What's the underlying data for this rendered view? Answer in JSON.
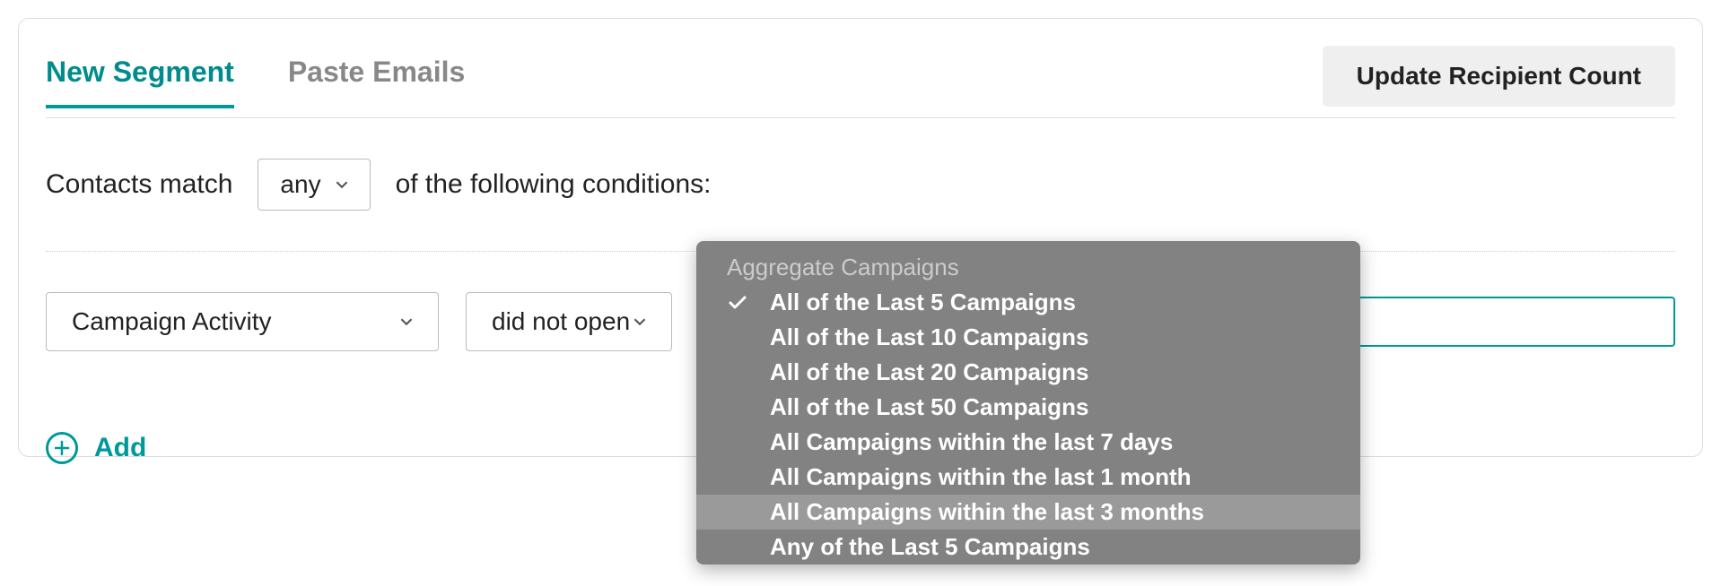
{
  "tabs": {
    "new_segment": "New Segment",
    "paste_emails": "Paste Emails"
  },
  "buttons": {
    "update_count": "Update Recipient Count",
    "add": "Add"
  },
  "conditions": {
    "prefix": "Contacts match",
    "match_mode": "any",
    "suffix": "of the following conditions:"
  },
  "row": {
    "field": "Campaign Activity",
    "operator": "did not open"
  },
  "dropdown": {
    "group_header": "Aggregate Campaigns",
    "items": [
      {
        "label": "All of the Last 5 Campaigns",
        "selected": true
      },
      {
        "label": "All of the Last 10 Campaigns",
        "selected": false
      },
      {
        "label": "All of the Last 20 Campaigns",
        "selected": false
      },
      {
        "label": "All of the Last 50 Campaigns",
        "selected": false
      },
      {
        "label": "All Campaigns within the last 7 days",
        "selected": false
      },
      {
        "label": "All Campaigns within the last 1 month",
        "selected": false
      },
      {
        "label": "All Campaigns within the last 3 months",
        "selected": false,
        "highlighted": true
      },
      {
        "label": "Any of the Last 5 Campaigns",
        "selected": false
      }
    ]
  }
}
